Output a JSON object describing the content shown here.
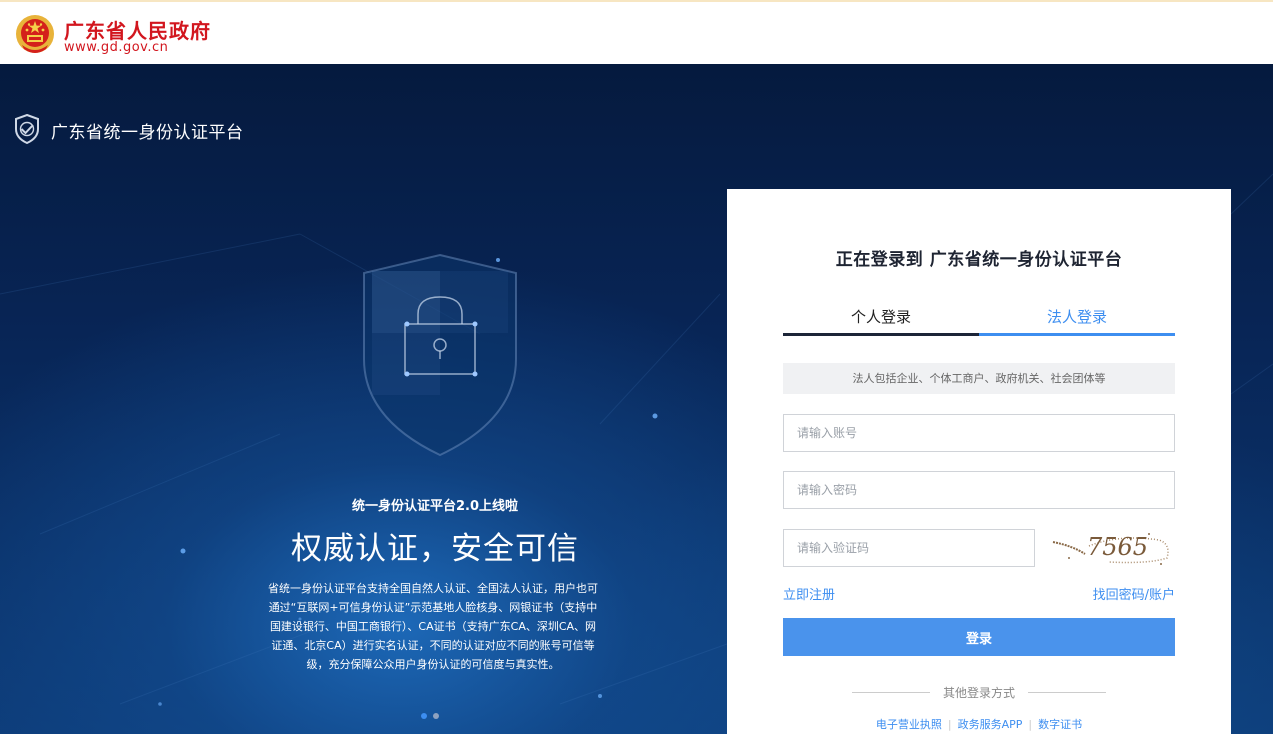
{
  "header": {
    "site_title": "广东省人民政府",
    "site_url": "www.gd.gov.cn",
    "emblem_icon": "national-emblem-icon"
  },
  "platform": {
    "name": "广东省统一身份认证平台",
    "logo_icon": "shield-check-icon"
  },
  "hero": {
    "subtitle": "统一身份认证平台2.0上线啦",
    "title": "权威认证，安全可信",
    "description": "省统一身份认证平台支持全国自然人认证、全国法人认证，用户也可通过“互联网+可信身份认证”示范基地人脸核身、网银证书（支持中国建设银行、中国工商银行）、CA证书（支持广东CA、深圳CA、网证通、北京CA）进行实名认证，不同的认证对应不同的账号可信等级，充分保障公众用户身份认证的可信度与真实性。",
    "carousel_total": 2,
    "carousel_active": 1
  },
  "login": {
    "title": "正在登录到 广东省统一身份认证平台",
    "tabs": [
      {
        "label": "个人登录",
        "active": false
      },
      {
        "label": "法人登录",
        "active": true
      }
    ],
    "notice": "法人包括企业、个体工商户、政府机关、社会团体等",
    "account_placeholder": "请输入账号",
    "password_placeholder": "请输入密码",
    "captcha_placeholder": "请输入验证码",
    "captcha_code": "7565",
    "register_link": "立即注册",
    "recover_link": "找回密码/账户",
    "login_button": "登录",
    "other_methods_label": "其他登录方式",
    "other_methods": [
      "电子营业执照",
      "政务服务APP",
      "数字证书"
    ]
  },
  "colors": {
    "brand_red": "#d2161e",
    "accent_blue": "#3d8ef0",
    "hero_dark": "#051a3e"
  }
}
